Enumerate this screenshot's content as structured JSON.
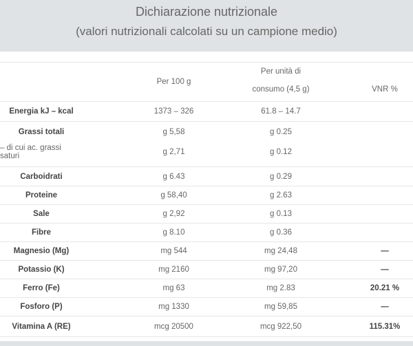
{
  "header": {
    "title": "Dichiarazione nutrizionale",
    "subtitle": "(valori nutrizionali calcolati su un campione medio)"
  },
  "columns": {
    "per_100g": "Per 100 g",
    "per_unit_line1": "Per unità di",
    "per_unit_line2": "consumo (4,5 g)",
    "vnr": "VNR %"
  },
  "rows": [
    {
      "label": "Energia kJ – kcal",
      "per100": "1373 – 326",
      "perUnit": "61.8 – 14.7",
      "vnr": ""
    },
    {
      "label": "Grassi totali",
      "per100": "g 5,58",
      "perUnit": "g 0.25",
      "vnr": ""
    },
    {
      "label": "– di cui ac. grassi saturi",
      "per100": "g 2,71",
      "perUnit": "g 0.12",
      "vnr": ""
    },
    {
      "label": "Carboidrati",
      "per100": "g 6.43",
      "perUnit": "g 0.29",
      "vnr": ""
    },
    {
      "label": "Proteine",
      "per100": "g 58,40",
      "perUnit": "g 2.63",
      "vnr": ""
    },
    {
      "label": "Sale",
      "per100": "g 2,92",
      "perUnit": "g 0.13",
      "vnr": ""
    },
    {
      "label": "Fibre",
      "per100": "g 8.10",
      "perUnit": "g 0.36",
      "vnr": ""
    },
    {
      "label": "Magnesio (Mg)",
      "per100": "mg 544",
      "perUnit": "mg 24,48",
      "vnr": "—"
    },
    {
      "label": "Potassio (K)",
      "per100": "mg 2160",
      "perUnit": "mg 97,20",
      "vnr": "—"
    },
    {
      "label": "Ferro (Fe)",
      "per100": "mg 63",
      "perUnit": "mg 2.83",
      "vnr": "20.21 %"
    },
    {
      "label": "Fosforo (P)",
      "per100": "mg 1330",
      "perUnit": "mg 59,85",
      "vnr": "—"
    },
    {
      "label": "Vitamina A (RE)",
      "per100": "mcg 20500",
      "perUnit": "mcg 922,50",
      "vnr": "115.31%"
    }
  ]
}
